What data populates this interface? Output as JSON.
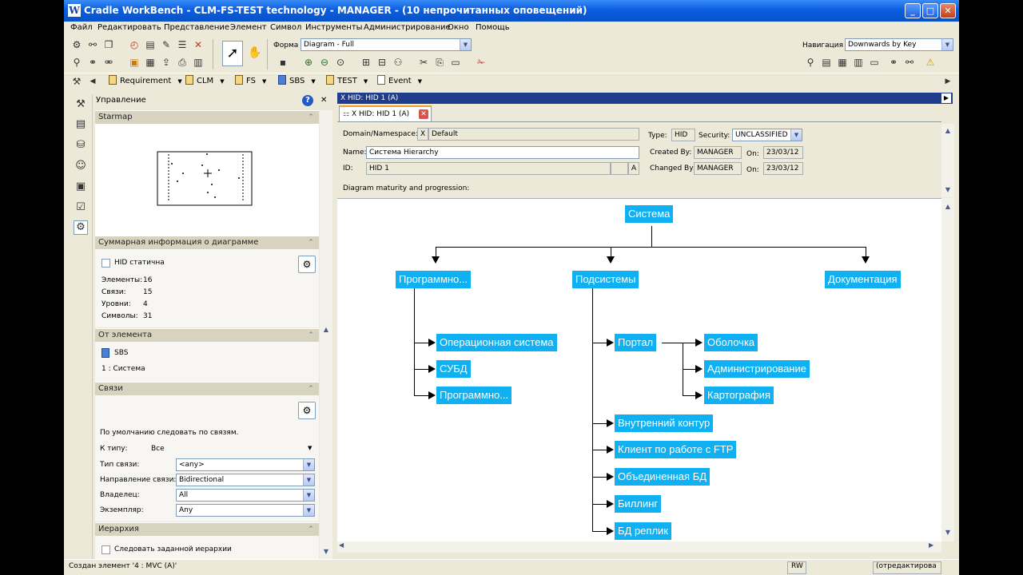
{
  "window": {
    "title": "Cradle WorkBench - CLM-FS-TEST technology - MANAGER - (10 непрочитанных оповещений)",
    "app_icon": "W",
    "btn_min": "_",
    "btn_max": "□",
    "btn_close": "✕"
  },
  "menu": [
    "Файл",
    "Редактировать",
    "Представление",
    "Элемент",
    "Символ",
    "Инструменты",
    "Администрирование",
    "Окно",
    "Помощь"
  ],
  "toolbar": {
    "forma_label": "Форма",
    "forma_value": "Diagram - Full",
    "nav_label": "Навигация",
    "nav_value": "Downwards by Key"
  },
  "categories": [
    {
      "label": "Requirement"
    },
    {
      "label": "CLM"
    },
    {
      "label": "FS"
    },
    {
      "label": "SBS"
    },
    {
      "label": "TEST"
    },
    {
      "label": "Event"
    }
  ],
  "left_panel": {
    "title": "Управление",
    "help": "?",
    "close": "✕",
    "starmap": {
      "header": "Starmap"
    },
    "summary": {
      "header": "Суммарная информация о диаграмме",
      "static_label": "HID статична",
      "rows": [
        {
          "label": "Элементы:",
          "value": "16"
        },
        {
          "label": "Связи:",
          "value": "15"
        },
        {
          "label": "Уровни:",
          "value": "4"
        },
        {
          "label": "Символы:",
          "value": "31"
        }
      ]
    },
    "from_element": {
      "header": "От элемента",
      "item": "SBS",
      "detail": "1 : Система"
    },
    "links": {
      "header": "Связи",
      "default_text": "По умолчанию следовать по связям.",
      "by_type_label": "К типу:",
      "by_type_value": "Все",
      "link_type_label": "Тип связи:",
      "link_type_value": "<any>",
      "direction_label": "Направление связи:",
      "direction_value": "Bidirectional",
      "owner_label": "Владелец:",
      "owner_value": "All",
      "instance_label": "Экземпляр:",
      "instance_value": "Any"
    },
    "hierarchy": {
      "header": "Иерархия",
      "follow_label": "Следовать заданной иерархии"
    }
  },
  "document": {
    "bar_title": "X HID: HID 1 (A)",
    "tab_label": "X HID: HID 1 (A)",
    "domain_label": "Domain/Namespace:",
    "domain_x": "X",
    "domain_value": "Default",
    "name_label": "Name:",
    "name_value": "Система Hierarchy",
    "id_label": "ID:",
    "id_value": "HID 1",
    "id_version": "A",
    "type_label": "Type:",
    "type_value": "HID",
    "security_label": "Security:",
    "security_value": "UNCLASSIFIED",
    "created_label": "Created By:",
    "created_value": "MANAGER",
    "created_on_label": "On:",
    "created_on_value": "23/03/12",
    "changed_label": "Changed By:",
    "changed_value": "MANAGER",
    "changed_on_label": "On:",
    "changed_on_value": "23/03/12",
    "maturity_label": "Diagram maturity and progression:"
  },
  "diagram": {
    "root": "Система",
    "level1": [
      "Программно...",
      "Подсистемы",
      "Документация"
    ],
    "sw_children": [
      "Операционная система",
      "СУБД",
      "Программно..."
    ],
    "sub_children": [
      "Портал",
      "Внутренний контур",
      "Клиент по работе с FTP",
      "Объединенная БД",
      "Биллинг",
      "БД реплик"
    ],
    "portal_children": [
      "Оболочка",
      "Администрирование",
      "Картография"
    ]
  },
  "status": {
    "message": "Создан элемент '4 : MVC (A)'",
    "mode": "RW",
    "edit_state": "(отредактирова"
  },
  "colors": {
    "node": "#0fb1f2",
    "titlebar": "#0a5ee0",
    "accent_bar": "#203c8c"
  }
}
